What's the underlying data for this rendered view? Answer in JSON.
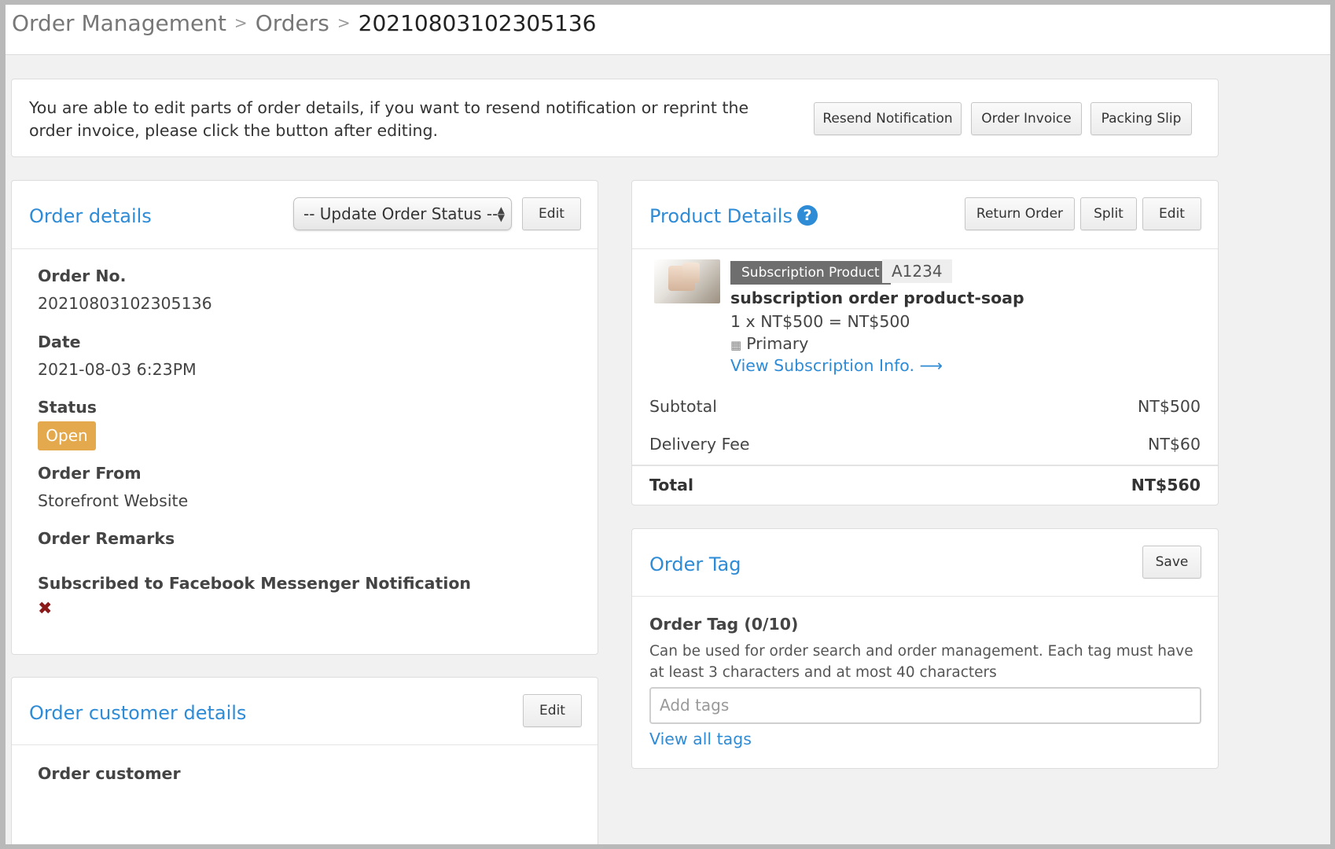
{
  "breadcrumb": {
    "items": [
      "Order Management",
      "Orders"
    ],
    "current": "20210803102305136"
  },
  "notice": {
    "text": "You are able to edit parts of order details, if you want to resend notification or reprint the order invoice, please click the button after editing.",
    "buttons": {
      "resend": "Resend Notification",
      "invoice": "Order Invoice",
      "packing": "Packing Slip"
    }
  },
  "order_details": {
    "title": "Order details",
    "status_select": "-- Update Order Status --",
    "edit_label": "Edit",
    "order_no_label": "Order No.",
    "order_no": "20210803102305136",
    "date_label": "Date",
    "date": "2021-08-03 6:23PM",
    "status_label": "Status",
    "status": "Open",
    "status_color": "#e4a94c",
    "order_from_label": "Order From",
    "order_from": "Storefront Website",
    "remarks_label": "Order Remarks",
    "messenger_label": "Subscribed to Facebook Messenger Notification",
    "messenger_icon": "x-icon"
  },
  "customer_details": {
    "title": "Order customer details",
    "edit_label": "Edit",
    "customer_label": "Order customer"
  },
  "product_details": {
    "title": "Product Details",
    "help_glyph": "?",
    "buttons": {
      "return": "Return Order",
      "split": "Split",
      "edit": "Edit"
    },
    "item": {
      "type_tag": "Subscription Product",
      "sku": "A1234",
      "name": "subscription order product-soap",
      "calc": "1 x NT$500 = NT$500",
      "warehouse_icon": "building-icon",
      "warehouse": "Primary",
      "link": "View Subscription Info. ⟶"
    },
    "subtotal_label": "Subtotal",
    "subtotal": "NT$500",
    "delivery_label": "Delivery Fee",
    "delivery": "NT$60",
    "total_label": "Total",
    "total": "NT$560"
  },
  "order_tag": {
    "title": "Order Tag",
    "save_label": "Save",
    "count_label": "Order Tag (0/10)",
    "description": "Can be used for order search and order management. Each tag must have at least 3 characters and at most 40 characters",
    "input_placeholder": "Add tags",
    "view_all": "View all tags"
  },
  "colors": {
    "accent": "#2e8bd6",
    "open_badge": "#e4a94c",
    "x_mark": "#8b1b1b"
  }
}
